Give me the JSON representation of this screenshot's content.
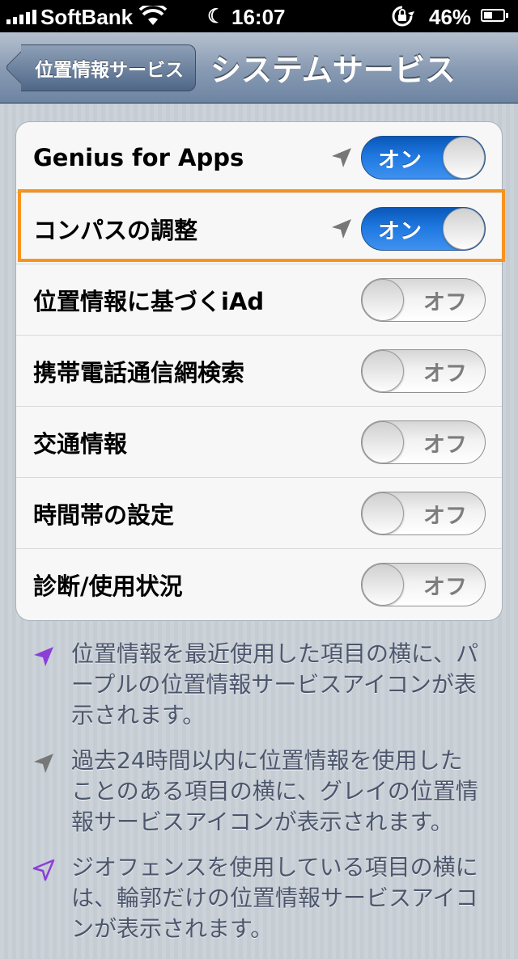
{
  "status_bar": {
    "carrier": "SoftBank",
    "time": "16:07",
    "battery": "46%",
    "battery_level": 0.46
  },
  "nav": {
    "back_label": "位置情報サービス",
    "title": "システムサービス"
  },
  "rows": [
    {
      "label": "Genius for Apps",
      "state": "オン",
      "on": true,
      "location_icon": "gray-arrow"
    },
    {
      "label": "コンパスの調整",
      "state": "オン",
      "on": true,
      "location_icon": "gray-arrow"
    },
    {
      "label": "位置情報に基づくiAd",
      "state": "オフ",
      "on": false
    },
    {
      "label": "携帯電話通信網検索",
      "state": "オフ",
      "on": false
    },
    {
      "label": "交通情報",
      "state": "オフ",
      "on": false
    },
    {
      "label": "時間帯の設定",
      "state": "オフ",
      "on": false
    },
    {
      "label": "診断/使用状況",
      "state": "オフ",
      "on": false
    }
  ],
  "notes": [
    {
      "icon": "purple-location-arrow",
      "text": "位置情報を最近使用した項目の横に、パープルの位置情報サービスアイコンが表示されます。"
    },
    {
      "icon": "gray-location-arrow",
      "text": "過去24時間以内に位置情報を使用したことのある項目の横に、グレイの位置情報サービスアイコンが表示されます。"
    },
    {
      "icon": "purple-outline-location-arrow",
      "text": "ジオフェンスを使用している項目の横には、輪郭だけの位置情報サービスアイコンが表示されます。"
    }
  ],
  "colors": {
    "toggle_on": "#1e78e0",
    "highlight": "#f7931e",
    "purple_icon": "#8b3fd8",
    "gray_icon": "#777777"
  }
}
